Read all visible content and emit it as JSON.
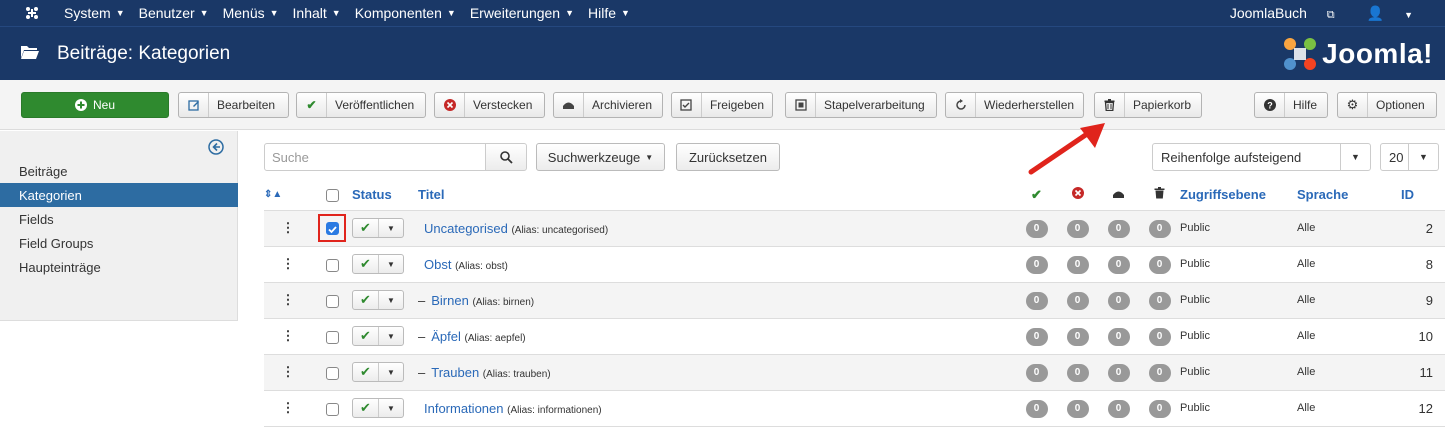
{
  "topnav": {
    "menus": [
      "System",
      "Benutzer",
      "Menüs",
      "Inhalt",
      "Komponenten",
      "Erweiterungen",
      "Hilfe"
    ],
    "site_link": "JoomlaBuch"
  },
  "header": {
    "title": "Beiträge: Kategorien",
    "brand": "Joomla!"
  },
  "toolbar": {
    "new": "Neu",
    "edit": "Bearbeiten",
    "publish": "Veröffentlichen",
    "unpublish": "Verstecken",
    "archive": "Archivieren",
    "checkin": "Freigeben",
    "batch": "Stapelverarbeitung",
    "rebuild": "Wiederherstellen",
    "trash": "Papierkorb",
    "help": "Hilfe",
    "options": "Optionen"
  },
  "sidebar": {
    "items": [
      "Beiträge",
      "Kategorien",
      "Fields",
      "Field Groups",
      "Haupteinträge"
    ],
    "active": "Kategorien"
  },
  "filters": {
    "search_placeholder": "Suche",
    "search_tools": "Suchwerkzeuge",
    "reset": "Zurücksetzen",
    "ordering": "Reihenfolge aufsteigend",
    "limit": "20"
  },
  "table": {
    "headers": {
      "status": "Status",
      "title": "Titel",
      "access": "Zugriffsebene",
      "language": "Sprache",
      "id": "ID"
    },
    "rows": [
      {
        "title": "Uncategorised",
        "alias": "(Alias: uncategorised)",
        "dash": "",
        "counts": [
          "0",
          "0",
          "0",
          "0"
        ],
        "access": "Public",
        "language": "Alle",
        "id": "2",
        "checked": true
      },
      {
        "title": "Obst",
        "alias": "(Alias: obst)",
        "dash": "",
        "counts": [
          "0",
          "0",
          "0",
          "0"
        ],
        "access": "Public",
        "language": "Alle",
        "id": "8",
        "checked": false
      },
      {
        "title": "Birnen",
        "alias": "(Alias: birnen)",
        "dash": "–",
        "counts": [
          "0",
          "0",
          "0",
          "0"
        ],
        "access": "Public",
        "language": "Alle",
        "id": "9",
        "checked": false
      },
      {
        "title": "Äpfel",
        "alias": "(Alias: aepfel)",
        "dash": "–",
        "counts": [
          "0",
          "0",
          "0",
          "0"
        ],
        "access": "Public",
        "language": "Alle",
        "id": "10",
        "checked": false
      },
      {
        "title": "Trauben",
        "alias": "(Alias: trauben)",
        "dash": "–",
        "counts": [
          "0",
          "0",
          "0",
          "0"
        ],
        "access": "Public",
        "language": "Alle",
        "id": "11",
        "checked": false
      },
      {
        "title": "Informationen",
        "alias": "(Alias: informationen)",
        "dash": "",
        "counts": [
          "0",
          "0",
          "0",
          "0"
        ],
        "access": "Public",
        "language": "Alle",
        "id": "12",
        "checked": false
      }
    ]
  },
  "colors": {
    "navy": "#1a3867",
    "link": "#2a69b8",
    "green": "#2f8a2f",
    "active": "#2d6ca2",
    "highlight": "#e0241c"
  }
}
